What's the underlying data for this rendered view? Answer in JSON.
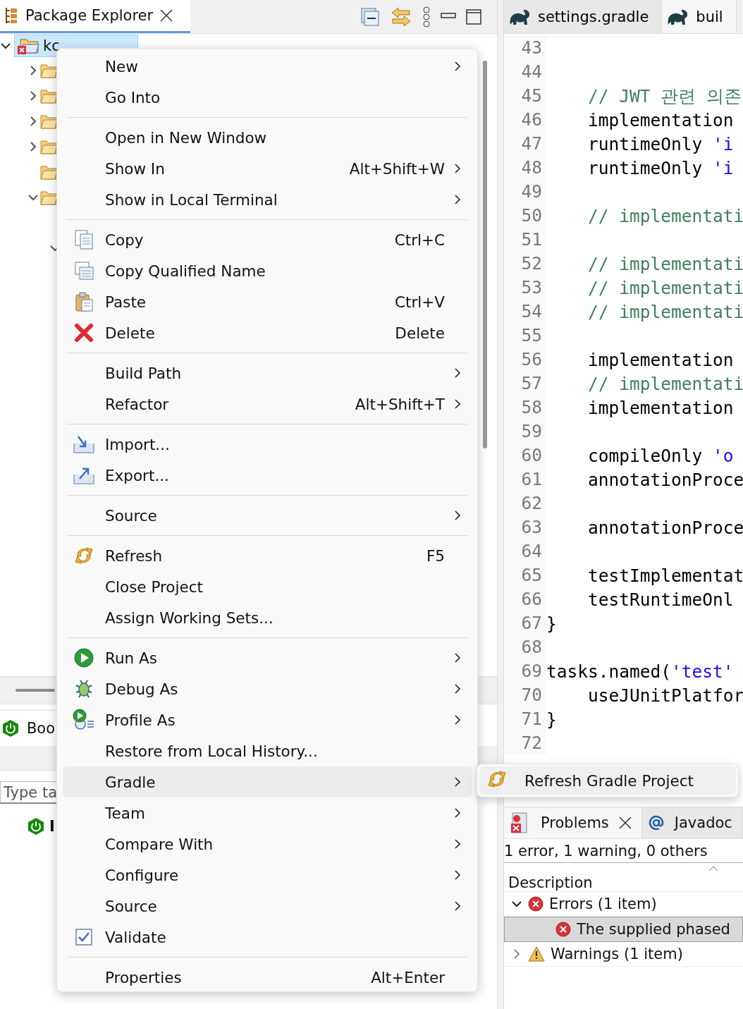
{
  "package_explorer": {
    "tab": {
      "title": "Package Explorer",
      "selected": true
    },
    "tree": {
      "label": "kc",
      "selected": true,
      "expanded": true,
      "children": [
        {
          "expandable": true,
          "expanded": false
        },
        {
          "expandable": true,
          "expanded": false
        },
        {
          "expandable": true,
          "expanded": false
        },
        {
          "expandable": true,
          "expanded": false
        },
        {
          "expandable": false
        },
        {
          "expandable": true,
          "expanded": true,
          "children": [
            {
              "expandable": true,
              "expanded": true
            }
          ]
        }
      ]
    }
  },
  "boot_dashboard": {
    "tab_label": "Boo",
    "search": {
      "placeholder": "Type ta"
    },
    "items": [
      {
        "label": "I"
      }
    ]
  },
  "editor": {
    "tabs": [
      {
        "label": "settings.gradle",
        "selected": false
      },
      {
        "label": "buil",
        "selected": true
      }
    ],
    "lines": [
      {
        "number": "43"
      },
      {
        "number": "44"
      },
      {
        "number": "45",
        "tokens": [
          {
            "kind": "comment",
            "text": "    // JWT 관련 의존"
          }
        ]
      },
      {
        "number": "46",
        "tokens": [
          {
            "kind": "plain",
            "text": "    implementation"
          }
        ]
      },
      {
        "number": "47",
        "tokens": [
          {
            "kind": "plain",
            "text": "    runtimeOnly "
          },
          {
            "kind": "string",
            "text": "'i"
          }
        ]
      },
      {
        "number": "48",
        "tokens": [
          {
            "kind": "plain",
            "text": "    runtimeOnly "
          },
          {
            "kind": "string",
            "text": "'i"
          }
        ]
      },
      {
        "number": "49"
      },
      {
        "number": "50",
        "tokens": [
          {
            "kind": "comment",
            "text": "    // implementati"
          }
        ]
      },
      {
        "number": "51"
      },
      {
        "number": "52",
        "tokens": [
          {
            "kind": "comment",
            "text": "    // implementati"
          }
        ]
      },
      {
        "number": "53",
        "tokens": [
          {
            "kind": "comment",
            "text": "    // implementati"
          }
        ]
      },
      {
        "number": "54",
        "tokens": [
          {
            "kind": "comment",
            "text": "    // implementati"
          }
        ]
      },
      {
        "number": "55"
      },
      {
        "number": "56",
        "tokens": [
          {
            "kind": "plain",
            "text": "    implementation"
          }
        ]
      },
      {
        "number": "57",
        "tokens": [
          {
            "kind": "comment",
            "text": "    // implementati"
          }
        ]
      },
      {
        "number": "58",
        "tokens": [
          {
            "kind": "plain",
            "text": "    implementation"
          }
        ]
      },
      {
        "number": "59"
      },
      {
        "number": "60",
        "tokens": [
          {
            "kind": "plain",
            "text": "    compileOnly "
          },
          {
            "kind": "string",
            "text": "'o"
          }
        ]
      },
      {
        "number": "61",
        "tokens": [
          {
            "kind": "plain",
            "text": "    annotationProce"
          }
        ]
      },
      {
        "number": "62"
      },
      {
        "number": "63",
        "tokens": [
          {
            "kind": "plain",
            "text": "    annotationProce"
          }
        ]
      },
      {
        "number": "64"
      },
      {
        "number": "65",
        "tokens": [
          {
            "kind": "plain",
            "text": "    testImplementat"
          }
        ]
      },
      {
        "number": "66",
        "tokens": [
          {
            "kind": "plain",
            "text": "    testRuntimeOnl"
          }
        ]
      },
      {
        "number": "67",
        "tokens": [
          {
            "kind": "plain",
            "text": "}"
          }
        ]
      },
      {
        "number": "68"
      },
      {
        "number": "69",
        "tokens": [
          {
            "kind": "plain",
            "text": "tasks.named("
          },
          {
            "kind": "string",
            "text": "'test'"
          }
        ]
      },
      {
        "number": "70",
        "tokens": [
          {
            "kind": "plain",
            "text": "    useJUnitPlatfor"
          }
        ]
      },
      {
        "number": "71",
        "tokens": [
          {
            "kind": "plain",
            "text": "}"
          }
        ]
      },
      {
        "number": "72"
      }
    ]
  },
  "context_menu": {
    "entries": [
      {
        "kind": "item",
        "label": "New",
        "submenu": true,
        "selected": false
      },
      {
        "kind": "item",
        "label": "Go Into",
        "submenu": false,
        "selected": false
      },
      {
        "kind": "separator"
      },
      {
        "kind": "item",
        "label": "Open in New Window",
        "submenu": false,
        "selected": false
      },
      {
        "kind": "item",
        "label": "Show In",
        "shortcut": "Alt+Shift+W",
        "submenu": true,
        "selected": false
      },
      {
        "kind": "item",
        "label": "Show in Local Terminal",
        "submenu": true,
        "selected": false
      },
      {
        "kind": "separator"
      },
      {
        "kind": "copy",
        "label": "Copy",
        "shortcut": "Ctrl+C",
        "submenu": false,
        "selected": false
      },
      {
        "kind": "copy-qualified",
        "label": "Copy Qualified Name",
        "submenu": false,
        "selected": false
      },
      {
        "kind": "paste",
        "label": "Paste",
        "shortcut": "Ctrl+V",
        "submenu": false,
        "selected": false
      },
      {
        "kind": "delete",
        "label": "Delete",
        "shortcut": "Delete",
        "submenu": false,
        "selected": false
      },
      {
        "kind": "separator"
      },
      {
        "kind": "item",
        "label": "Build Path",
        "submenu": true,
        "selected": false
      },
      {
        "kind": "item",
        "label": "Refactor",
        "shortcut": "Alt+Shift+T",
        "submenu": true,
        "selected": false
      },
      {
        "kind": "separator"
      },
      {
        "kind": "import",
        "label": "Import...",
        "submenu": false,
        "selected": false
      },
      {
        "kind": "export",
        "label": "Export...",
        "submenu": false,
        "selected": false
      },
      {
        "kind": "separator"
      },
      {
        "kind": "item",
        "label": "Source",
        "submenu": true,
        "selected": false
      },
      {
        "kind": "separator"
      },
      {
        "kind": "refresh",
        "label": "Refresh",
        "shortcut": "F5",
        "submenu": false,
        "selected": false
      },
      {
        "kind": "item",
        "label": "Close Project",
        "submenu": false,
        "selected": false
      },
      {
        "kind": "item",
        "label": "Assign Working Sets...",
        "submenu": false,
        "selected": false
      },
      {
        "kind": "separator"
      },
      {
        "kind": "run",
        "label": "Run As",
        "submenu": true,
        "selected": false
      },
      {
        "kind": "debug",
        "label": "Debug As",
        "submenu": true,
        "selected": false
      },
      {
        "kind": "profile",
        "label": "Profile As",
        "submenu": true,
        "selected": false
      },
      {
        "kind": "item",
        "label": "Restore from Local History...",
        "submenu": false,
        "selected": false
      },
      {
        "kind": "item",
        "label": "Gradle",
        "submenu": true,
        "selected": true
      },
      {
        "kind": "item",
        "label": "Team",
        "submenu": true,
        "selected": false
      },
      {
        "kind": "item",
        "label": "Compare With",
        "submenu": true,
        "selected": false
      },
      {
        "kind": "item",
        "label": "Configure",
        "submenu": true,
        "selected": false
      },
      {
        "kind": "item",
        "label": "Source",
        "submenu": true,
        "selected": false
      },
      {
        "kind": "validate",
        "label": "Validate",
        "submenu": false,
        "selected": false
      },
      {
        "kind": "separator"
      },
      {
        "kind": "item",
        "label": "Properties",
        "shortcut": "Alt+Enter",
        "submenu": false,
        "selected": false
      }
    ]
  },
  "submenu": {
    "entries": [
      {
        "kind": "refresh",
        "label": "Refresh Gradle Project"
      }
    ]
  },
  "problems": {
    "tabs": [
      {
        "label": "Problems",
        "selected": true,
        "closable": true
      },
      {
        "label": "Javadoc",
        "selected": false,
        "closable": false
      }
    ],
    "summary": "1 error, 1 warning, 0 others",
    "column": "Description",
    "tree": [
      {
        "kind": "error",
        "label": "Errors (1 item)",
        "expanded": true,
        "children": [
          {
            "kind": "error",
            "label": "The supplied phased",
            "selected": true
          }
        ]
      },
      {
        "kind": "warning",
        "label": "Warnings (1 item)",
        "expanded": false
      }
    ]
  }
}
